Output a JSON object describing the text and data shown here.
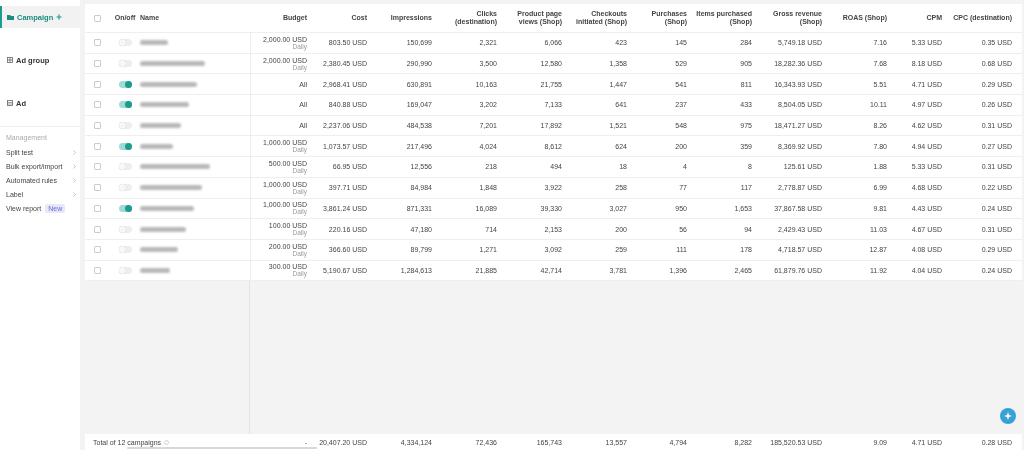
{
  "sidebar": {
    "levels": [
      {
        "label": "Campaign",
        "selected": true,
        "kind": "campaign"
      },
      {
        "label": "Ad group",
        "selected": false,
        "kind": "adgroup"
      },
      {
        "label": "Ad",
        "selected": false,
        "kind": "ad"
      }
    ],
    "section_title": "Management",
    "items": [
      {
        "label": "Split test",
        "kind": "submenu"
      },
      {
        "label": "Bulk export/import",
        "kind": "submenu"
      },
      {
        "label": "Automated rules",
        "kind": "submenu"
      },
      {
        "label": "Label",
        "kind": "submenu"
      },
      {
        "label": "View report",
        "kind": "link",
        "badge": "New"
      }
    ]
  },
  "table": {
    "all_checked": false,
    "columns": [
      "On/off",
      "Name",
      "Budget",
      "Cost",
      "Impressions",
      "Clicks (destination)",
      "Product page views (Shop)",
      "Checkouts initiated (Shop)",
      "Purchases (Shop)",
      "Items purchased (Shop)",
      "Gross revenue (Shop)",
      "ROAS (Shop)",
      "CPM",
      "CPC (destination)"
    ],
    "rows": [
      {
        "checked": false,
        "on": false,
        "budget_period": "Daily",
        "cells": [
          "",
          "",
          "2,000.00 USD",
          "803.50 USD",
          "150,699",
          "2,321",
          "6,066",
          "423",
          "145",
          "284",
          "5,749.18 USD",
          "7.16",
          "5.33 USD",
          "0.35 USD"
        ]
      },
      {
        "checked": false,
        "on": false,
        "budget_period": "Daily",
        "cells": [
          "",
          "",
          "2,000.00 USD",
          "2,380.45 USD",
          "290,990",
          "3,500",
          "12,580",
          "1,358",
          "529",
          "905",
          "18,282.36 USD",
          "7.68",
          "8.18 USD",
          "0.68 USD"
        ]
      },
      {
        "checked": false,
        "on": true,
        "cells": [
          "",
          "",
          "All",
          "2,968.41 USD",
          "630,891",
          "10,163",
          "21,755",
          "1,447",
          "541",
          "811",
          "16,343.93 USD",
          "5.51",
          "4.71 USD",
          "0.29 USD"
        ]
      },
      {
        "checked": false,
        "on": true,
        "cells": [
          "",
          "",
          "All",
          "840.88 USD",
          "169,047",
          "3,202",
          "7,133",
          "641",
          "237",
          "433",
          "8,504.05 USD",
          "10.11",
          "4.97 USD",
          "0.26 USD"
        ]
      },
      {
        "checked": false,
        "on": false,
        "cells": [
          "",
          "",
          "All",
          "2,237.06 USD",
          "484,538",
          "7,201",
          "17,892",
          "1,521",
          "548",
          "975",
          "18,471.27 USD",
          "8.26",
          "4.62 USD",
          "0.31 USD"
        ]
      },
      {
        "checked": false,
        "on": true,
        "budget_period": "Daily",
        "cells": [
          "",
          "",
          "1,000.00 USD",
          "1,073.57 USD",
          "217,496",
          "4,024",
          "8,612",
          "624",
          "200",
          "359",
          "8,369.92 USD",
          "7.80",
          "4.94 USD",
          "0.27 USD"
        ]
      },
      {
        "checked": false,
        "on": false,
        "budget_period": "Daily",
        "cells": [
          "",
          "",
          "500.00 USD",
          "66.95 USD",
          "12,556",
          "218",
          "494",
          "18",
          "4",
          "8",
          "125.61 USD",
          "1.88",
          "5.33 USD",
          "0.31 USD"
        ]
      },
      {
        "checked": false,
        "on": false,
        "budget_period": "Daily",
        "cells": [
          "",
          "",
          "1,000.00 USD",
          "397.71 USD",
          "84,984",
          "1,848",
          "3,922",
          "258",
          "77",
          "117",
          "2,778.87 USD",
          "6.99",
          "4.68 USD",
          "0.22 USD"
        ]
      },
      {
        "checked": false,
        "on": true,
        "budget_period": "Daily",
        "cells": [
          "",
          "",
          "1,000.00 USD",
          "3,861.24 USD",
          "871,331",
          "16,089",
          "39,330",
          "3,027",
          "950",
          "1,653",
          "37,867.58 USD",
          "9.81",
          "4.43 USD",
          "0.24 USD"
        ]
      },
      {
        "checked": false,
        "on": false,
        "budget_period": "Daily",
        "cells": [
          "",
          "",
          "100.00 USD",
          "220.16 USD",
          "47,180",
          "714",
          "2,153",
          "200",
          "56",
          "94",
          "2,429.43 USD",
          "11.03",
          "4.67 USD",
          "0.31 USD"
        ]
      },
      {
        "checked": false,
        "on": false,
        "budget_period": "Daily",
        "cells": [
          "",
          "",
          "200.00 USD",
          "366.60 USD",
          "89,799",
          "1,271",
          "3,092",
          "259",
          "111",
          "178",
          "4,718.57 USD",
          "12.87",
          "4.08 USD",
          "0.29 USD"
        ]
      },
      {
        "checked": false,
        "on": false,
        "budget_period": "Daily",
        "cells": [
          "",
          "",
          "300.00 USD",
          "5,190.67 USD",
          "1,284,613",
          "21,885",
          "42,714",
          "3,781",
          "1,396",
          "2,465",
          "61,879.76 USD",
          "11.92",
          "4.04 USD",
          "0.24 USD"
        ]
      }
    ],
    "total": {
      "label": "Total of 12 campaigns",
      "cells": [
        "",
        "",
        "-",
        "20,407.20 USD",
        "4,334,124",
        "72,436",
        "165,743",
        "13,557",
        "4,794",
        "8,282",
        "185,520.53 USD",
        "9.09",
        "4.71 USD",
        "0.28 USD"
      ]
    }
  }
}
